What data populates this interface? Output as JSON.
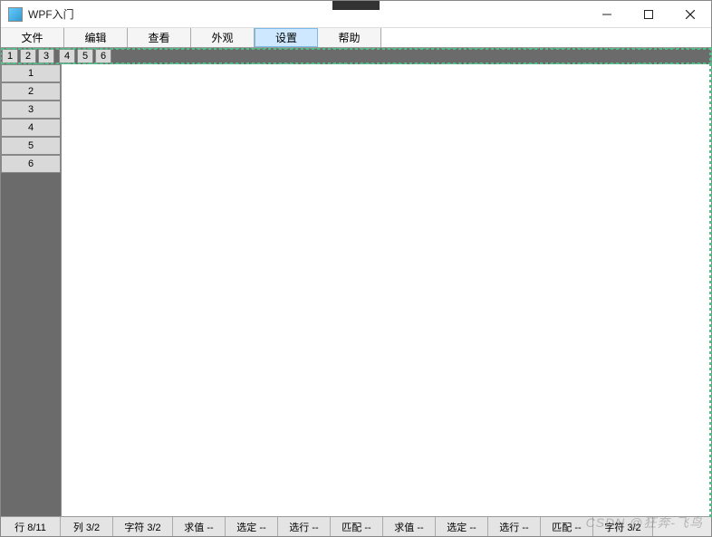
{
  "window": {
    "title": "WPF入门"
  },
  "menu": {
    "items": [
      {
        "label": "文件",
        "selected": false
      },
      {
        "label": "编辑",
        "selected": false
      },
      {
        "label": "查看",
        "selected": false
      },
      {
        "label": "外观",
        "selected": false
      },
      {
        "label": "设置",
        "selected": true
      },
      {
        "label": "帮助",
        "selected": false
      }
    ]
  },
  "toolbar": {
    "buttons": [
      "1",
      "2",
      "3",
      "4",
      "5",
      "6"
    ]
  },
  "rows": {
    "headers": [
      "1",
      "2",
      "3",
      "4",
      "5",
      "6"
    ]
  },
  "status": {
    "cells": [
      "行 8/11",
      "列 3/2",
      "字符 3/2",
      "求值 --",
      "选定 --",
      "选行 --",
      "匹配 --",
      "求值 --",
      "选定 --",
      "选行 --",
      "匹配 --",
      "字符 3/2"
    ]
  },
  "watermark": "CSDN @狂奔-飞鸟"
}
